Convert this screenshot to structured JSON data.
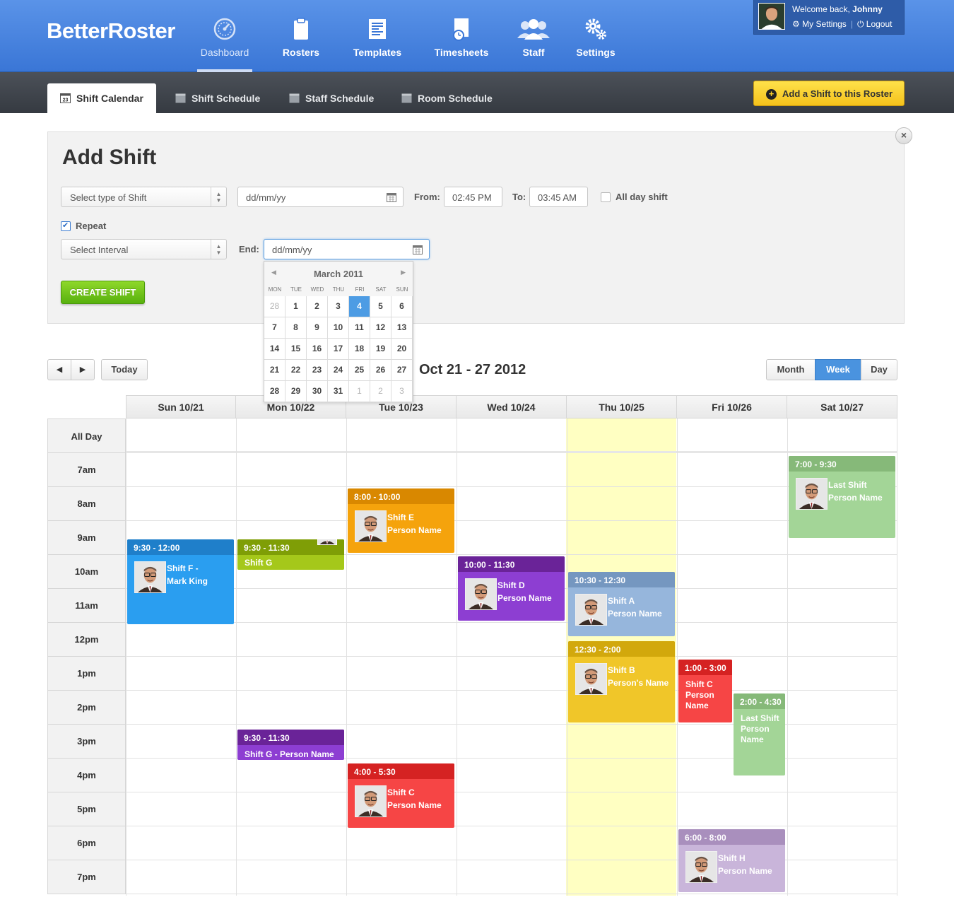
{
  "app": {
    "logo_bold": "Better",
    "logo_rest": "Roster"
  },
  "nav": [
    {
      "label": "Dashboard",
      "icon": "dashboard-gauge-icon",
      "active": true
    },
    {
      "label": "Rosters",
      "icon": "clipboard-icon",
      "active": false
    },
    {
      "label": "Templates",
      "icon": "template-document-icon",
      "active": false
    },
    {
      "label": "Timesheets",
      "icon": "timesheet-clock-icon",
      "active": false
    },
    {
      "label": "Staff",
      "icon": "staff-people-icon",
      "active": false
    },
    {
      "label": "Settings",
      "icon": "settings-gears-icon",
      "active": false
    }
  ],
  "user": {
    "welcome": "Welcome back, ",
    "name": "Johnny",
    "settings_label": "My Settings",
    "logout_label": "Logout"
  },
  "tabs": [
    {
      "label": "Shift Calendar",
      "active": true
    },
    {
      "label": "Shift Schedule",
      "active": false
    },
    {
      "label": "Staff Schedule",
      "active": false
    },
    {
      "label": "Room Schedule",
      "active": false
    }
  ],
  "add_shift_button": "Add a Shift to this Roster",
  "form": {
    "title": "Add Shift",
    "shift_type_placeholder": "Select type of Shift",
    "date_placeholder": "dd/mm/yy",
    "from_label": "From:",
    "from_value": "02:45 PM",
    "to_label": "To:",
    "to_value": "03:45 AM",
    "all_day_label": "All day shift",
    "all_day_checked": false,
    "repeat_label": "Repeat",
    "repeat_checked": true,
    "interval_placeholder": "Select Interval",
    "end_label": "End:",
    "end_placeholder": "dd/mm/yy",
    "create_button": "CREATE SHIFT",
    "close_symbol": "×"
  },
  "datepicker": {
    "month_label": "March 2011",
    "prev_symbol": "◀",
    "next_symbol": "▶",
    "weekdays": [
      "MON",
      "TUE",
      "WED",
      "THU",
      "FRI",
      "SAT",
      "SUN"
    ],
    "days": [
      {
        "d": "28",
        "muted": true
      },
      {
        "d": "1"
      },
      {
        "d": "2"
      },
      {
        "d": "3"
      },
      {
        "d": "4",
        "selected": true
      },
      {
        "d": "5"
      },
      {
        "d": "6"
      },
      {
        "d": "7"
      },
      {
        "d": "8"
      },
      {
        "d": "9"
      },
      {
        "d": "10"
      },
      {
        "d": "11"
      },
      {
        "d": "12"
      },
      {
        "d": "13"
      },
      {
        "d": "14"
      },
      {
        "d": "15"
      },
      {
        "d": "16"
      },
      {
        "d": "17"
      },
      {
        "d": "18"
      },
      {
        "d": "19"
      },
      {
        "d": "20"
      },
      {
        "d": "21"
      },
      {
        "d": "22"
      },
      {
        "d": "23"
      },
      {
        "d": "24"
      },
      {
        "d": "25"
      },
      {
        "d": "26"
      },
      {
        "d": "27"
      },
      {
        "d": "28"
      },
      {
        "d": "29"
      },
      {
        "d": "30"
      },
      {
        "d": "31"
      },
      {
        "d": "1",
        "muted": true
      },
      {
        "d": "2",
        "muted": true
      },
      {
        "d": "3",
        "muted": true
      }
    ]
  },
  "calendar": {
    "prev_symbol": "◀",
    "next_symbol": "▶",
    "today_label": "Today",
    "range_title": "Oct 21 - 27 2012",
    "views": [
      {
        "label": "Month",
        "active": false
      },
      {
        "label": "Week",
        "active": true
      },
      {
        "label": "Day",
        "active": false
      }
    ],
    "days": [
      "Sun 10/21",
      "Mon 10/22",
      "Tue 10/23",
      "Wed 10/24",
      "Thu 10/25",
      "Fri 10/26",
      "Sat 10/27"
    ],
    "today_index": 4,
    "all_day_label": "All Day",
    "hours": [
      "7am",
      "8am",
      "9am",
      "10am",
      "11am",
      "12pm",
      "1pm",
      "2pm",
      "3pm",
      "4pm",
      "5pm",
      "6pm",
      "7pm"
    ],
    "events": [
      {
        "day": 0,
        "start": 9.5,
        "end": 12,
        "time": "9:30 - 12:00",
        "lines": [
          "Shift F -",
          "Mark King"
        ],
        "head": "#1f7fca",
        "body": "#2a9ef0",
        "style": "photo"
      },
      {
        "day": 1,
        "start": 9.5,
        "end": 10.4,
        "time": "9:30 - 11:30",
        "lines": [
          "Shift G"
        ],
        "head": "#7f9e06",
        "body": "#a5c81a",
        "style": "mini"
      },
      {
        "day": 2,
        "start": 8,
        "end": 9.9,
        "time": "8:00 - 10:00",
        "lines": [
          "Shift E",
          "Person Name"
        ],
        "head": "#d98800",
        "body": "#f5a30c",
        "style": "photo"
      },
      {
        "day": 3,
        "start": 10,
        "end": 11.9,
        "time": "10:00 - 11:30",
        "lines": [
          "Shift D",
          "Person Name"
        ],
        "head": "#6a2398",
        "body": "#8d3ed2",
        "style": "photo"
      },
      {
        "day": 4,
        "start": 10.45,
        "end": 12.35,
        "time": "10:30 - 12:30",
        "lines": [
          "Shift A",
          "Person Name"
        ],
        "head": "#7597c0",
        "body": "#96b6dc",
        "style": "photo"
      },
      {
        "day": 4,
        "start": 12.5,
        "end": 14.9,
        "time": "12:30 - 2:00",
        "lines": [
          "Shift B",
          "Person's Name"
        ],
        "head": "#d2a80c",
        "body": "#f0c629",
        "style": "photo"
      },
      {
        "day": 5,
        "start": 13.05,
        "end": 14.9,
        "time": "1:00 - 3:00",
        "lines": [
          "Shift C",
          "Person",
          "Name"
        ],
        "head": "#d52222",
        "body": "#f64545",
        "style": "compact",
        "narrow": "left"
      },
      {
        "day": 5,
        "start": 14.05,
        "end": 16.45,
        "time": "2:00 - 4:30",
        "lines": [
          "Last Shift",
          "Person",
          "Name"
        ],
        "head": "#86b979",
        "body": "#a3d597",
        "style": "compact",
        "narrow": "right"
      },
      {
        "day": 6,
        "start": 7.05,
        "end": 9.45,
        "time": "7:00 - 9:30",
        "lines": [
          "Last Shift",
          "Person Name"
        ],
        "head": "#86b979",
        "body": "#a3d597",
        "style": "photo"
      },
      {
        "day": 1,
        "start": 15.1,
        "end": 16.0,
        "time": "9:30 - 11:30",
        "lines": [
          "Shift G - Person Name"
        ],
        "head": "#6a2398",
        "body": "#8d3ed2",
        "style": "compact"
      },
      {
        "day": 2,
        "start": 16.1,
        "end": 18.0,
        "time": "4:00 - 5:30",
        "lines": [
          "Shift C",
          "Person Name"
        ],
        "head": "#d52222",
        "body": "#f64545",
        "style": "photo"
      },
      {
        "day": 5,
        "start": 18.05,
        "end": 19.9,
        "time": "6:00 - 8:00",
        "lines": [
          "Shift H",
          "Person Name"
        ],
        "head": "#a98fbd",
        "body": "#c9b5da",
        "style": "photo"
      }
    ]
  },
  "colors": {
    "header_blue": "#3a76d6",
    "accent_yellow": "#f4c21c",
    "create_green": "#58b10e",
    "today_highlight": "#ffffc2",
    "active_view": "#4a93df"
  }
}
